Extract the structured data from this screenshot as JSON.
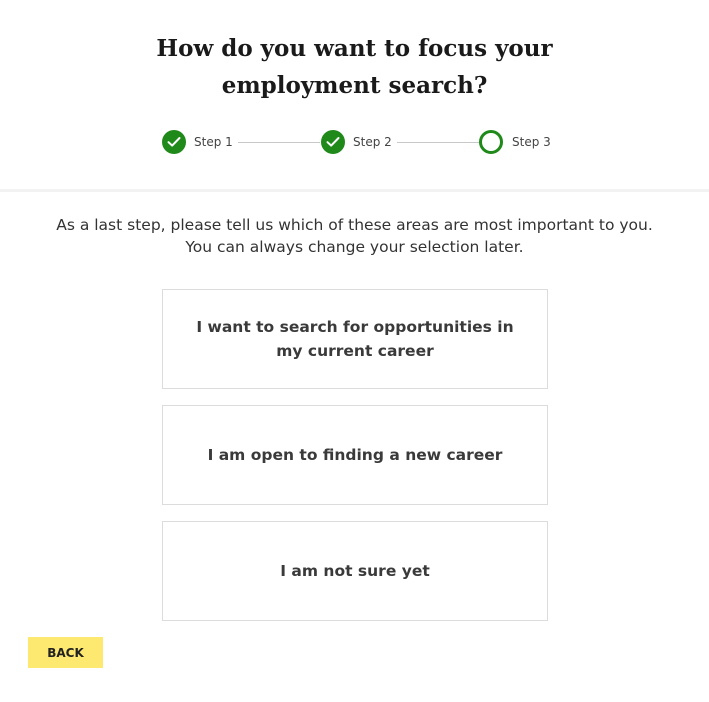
{
  "header": {
    "title_line1": "How do you want to focus your",
    "title_line2": "employment search?"
  },
  "stepper": {
    "steps": [
      {
        "label": "Step 1",
        "status": "complete"
      },
      {
        "label": "Step 2",
        "status": "complete"
      },
      {
        "label": "Step 3",
        "status": "current"
      }
    ],
    "accent_color": "#1f8a1a"
  },
  "intro": {
    "line1": "As a last step, please tell us which of these areas are most important to you.",
    "line2": "You can always change your selection later."
  },
  "options": [
    {
      "label": "I want to search for opportunities in my current career"
    },
    {
      "label": "I am open to finding a new career"
    },
    {
      "label": "I am not sure yet"
    }
  ],
  "footer": {
    "back_label": "BACK",
    "back_color": "#fde96f"
  }
}
